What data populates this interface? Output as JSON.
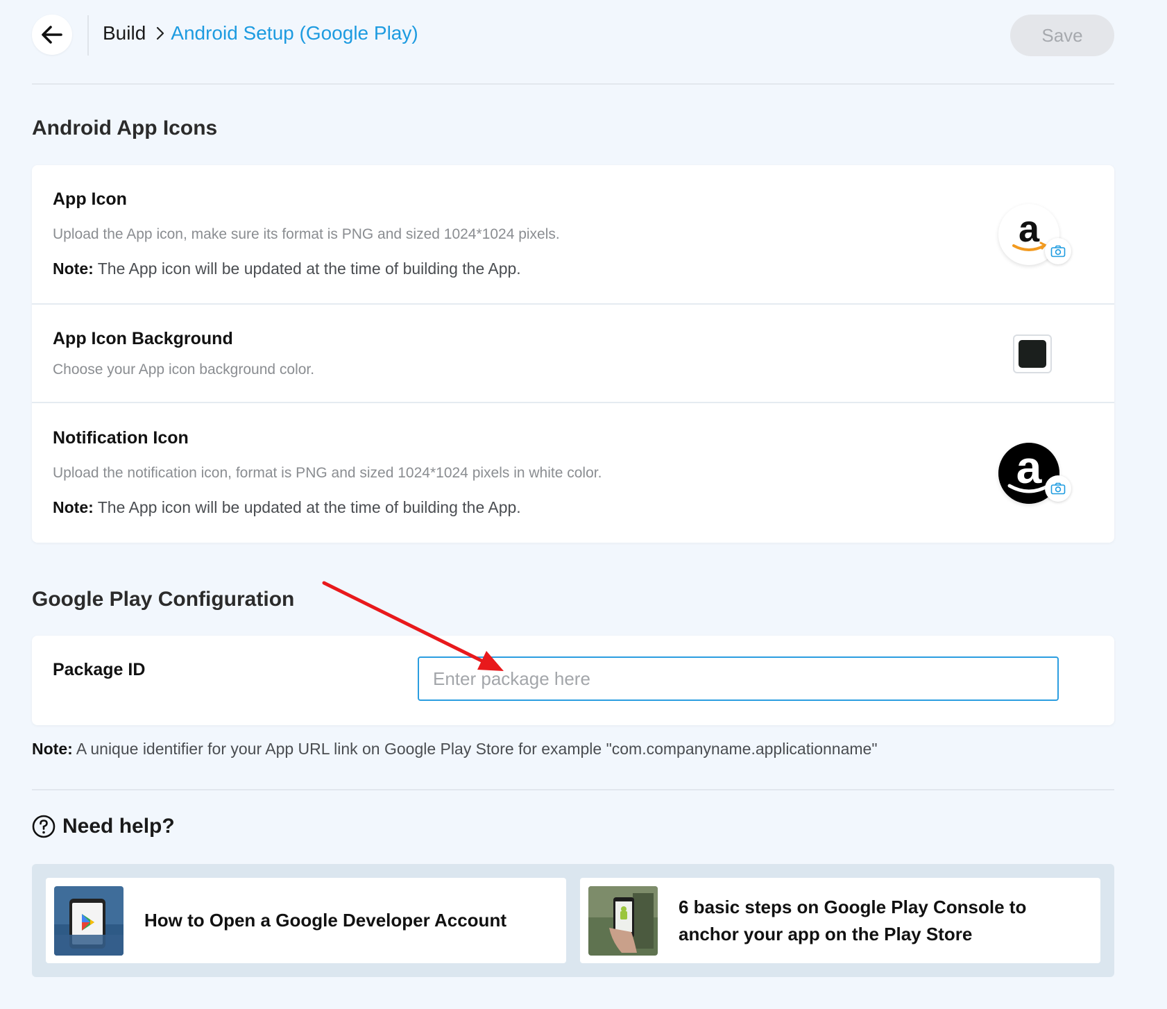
{
  "header": {
    "breadcrumb_root": "Build",
    "breadcrumb_current": "Android Setup (Google Play)",
    "save_label": "Save"
  },
  "icons_section": {
    "title": "Android App Icons",
    "app_icon": {
      "title": "App Icon",
      "description": "Upload the App icon, make sure its format is PNG and sized 1024*1024 pixels.",
      "note_label": "Note:",
      "note_text": " The App icon will be updated at the time of building the App."
    },
    "app_icon_background": {
      "title": "App Icon Background",
      "description": "Choose your App icon background color.",
      "color": "#1b1f1d"
    },
    "notification_icon": {
      "title": "Notification Icon",
      "description": "Upload the notification icon, format is PNG and sized 1024*1024 pixels in white color.",
      "note_label": "Note:",
      "note_text": " The App icon will be updated at the time of building the App."
    }
  },
  "play_section": {
    "title": "Google Play Configuration",
    "package_label": "Package ID",
    "package_value": "",
    "package_placeholder": "Enter package here",
    "note_label": "Note:",
    "note_text": " A unique identifier for your App URL link on Google Play Store for example \"com.companyname.applicationname\""
  },
  "help": {
    "title": "Need help?",
    "articles": [
      {
        "title": "How to Open a Google Developer Account"
      },
      {
        "title_line1": "6 basic steps on Google Play Console to",
        "title_line2": "anchor your app on the Play Store"
      }
    ]
  },
  "colors": {
    "accent": "#1d9be0",
    "annotation_arrow": "#e8191c",
    "background": "#f2f7fd"
  }
}
